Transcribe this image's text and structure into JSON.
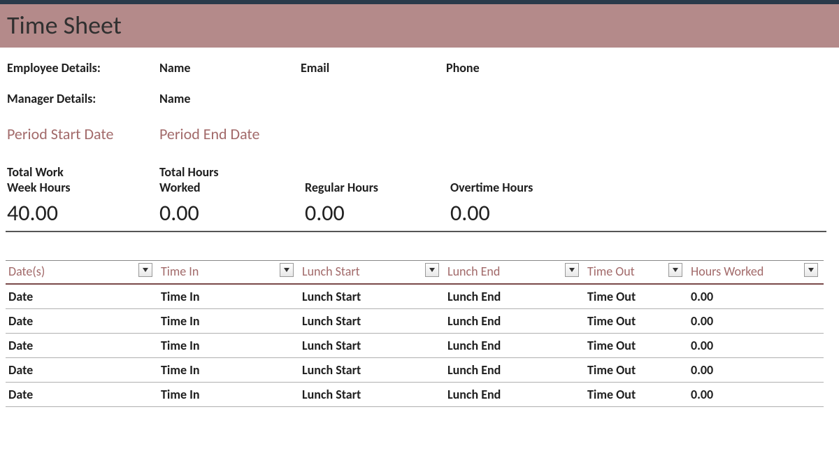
{
  "title": "Time Sheet",
  "details": {
    "employee_label": "Employee Details:",
    "employee_name": "Name",
    "employee_email": "Email",
    "employee_phone": "Phone",
    "manager_label": "Manager Details:",
    "manager_name": "Name"
  },
  "period": {
    "start_label": "Period Start Date",
    "end_label": "Period End Date"
  },
  "summary": {
    "total_week_hours_label_line1": "Total Work",
    "total_week_hours_label_line2": "Week Hours",
    "total_hours_worked_label_line1": "Total Hours",
    "total_hours_worked_label_line2": "Worked",
    "regular_hours_label": "Regular Hours",
    "overtime_hours_label": "Overtime Hours",
    "total_week_hours": "40.00",
    "total_hours_worked": "0.00",
    "regular_hours": "0.00",
    "overtime_hours": "0.00"
  },
  "table": {
    "headers": {
      "date": "Date(s)",
      "time_in": "Time In",
      "lunch_start": "Lunch Start",
      "lunch_end": "Lunch End",
      "time_out": "Time Out",
      "hours_worked": "Hours Worked"
    },
    "rows": [
      {
        "date": "Date",
        "time_in": "Time In",
        "lunch_start": "Lunch Start",
        "lunch_end": "Lunch End",
        "time_out": "Time Out",
        "hours_worked": "0.00"
      },
      {
        "date": "Date",
        "time_in": "Time In",
        "lunch_start": "Lunch Start",
        "lunch_end": "Lunch End",
        "time_out": "Time Out",
        "hours_worked": "0.00"
      },
      {
        "date": "Date",
        "time_in": "Time In",
        "lunch_start": "Lunch Start",
        "lunch_end": "Lunch End",
        "time_out": "Time Out",
        "hours_worked": "0.00"
      },
      {
        "date": "Date",
        "time_in": "Time In",
        "lunch_start": "Lunch Start",
        "lunch_end": "Lunch End",
        "time_out": "Time Out",
        "hours_worked": "0.00"
      },
      {
        "date": "Date",
        "time_in": "Time In",
        "lunch_start": "Lunch Start",
        "lunch_end": "Lunch End",
        "time_out": "Time Out",
        "hours_worked": "0.00"
      }
    ]
  }
}
